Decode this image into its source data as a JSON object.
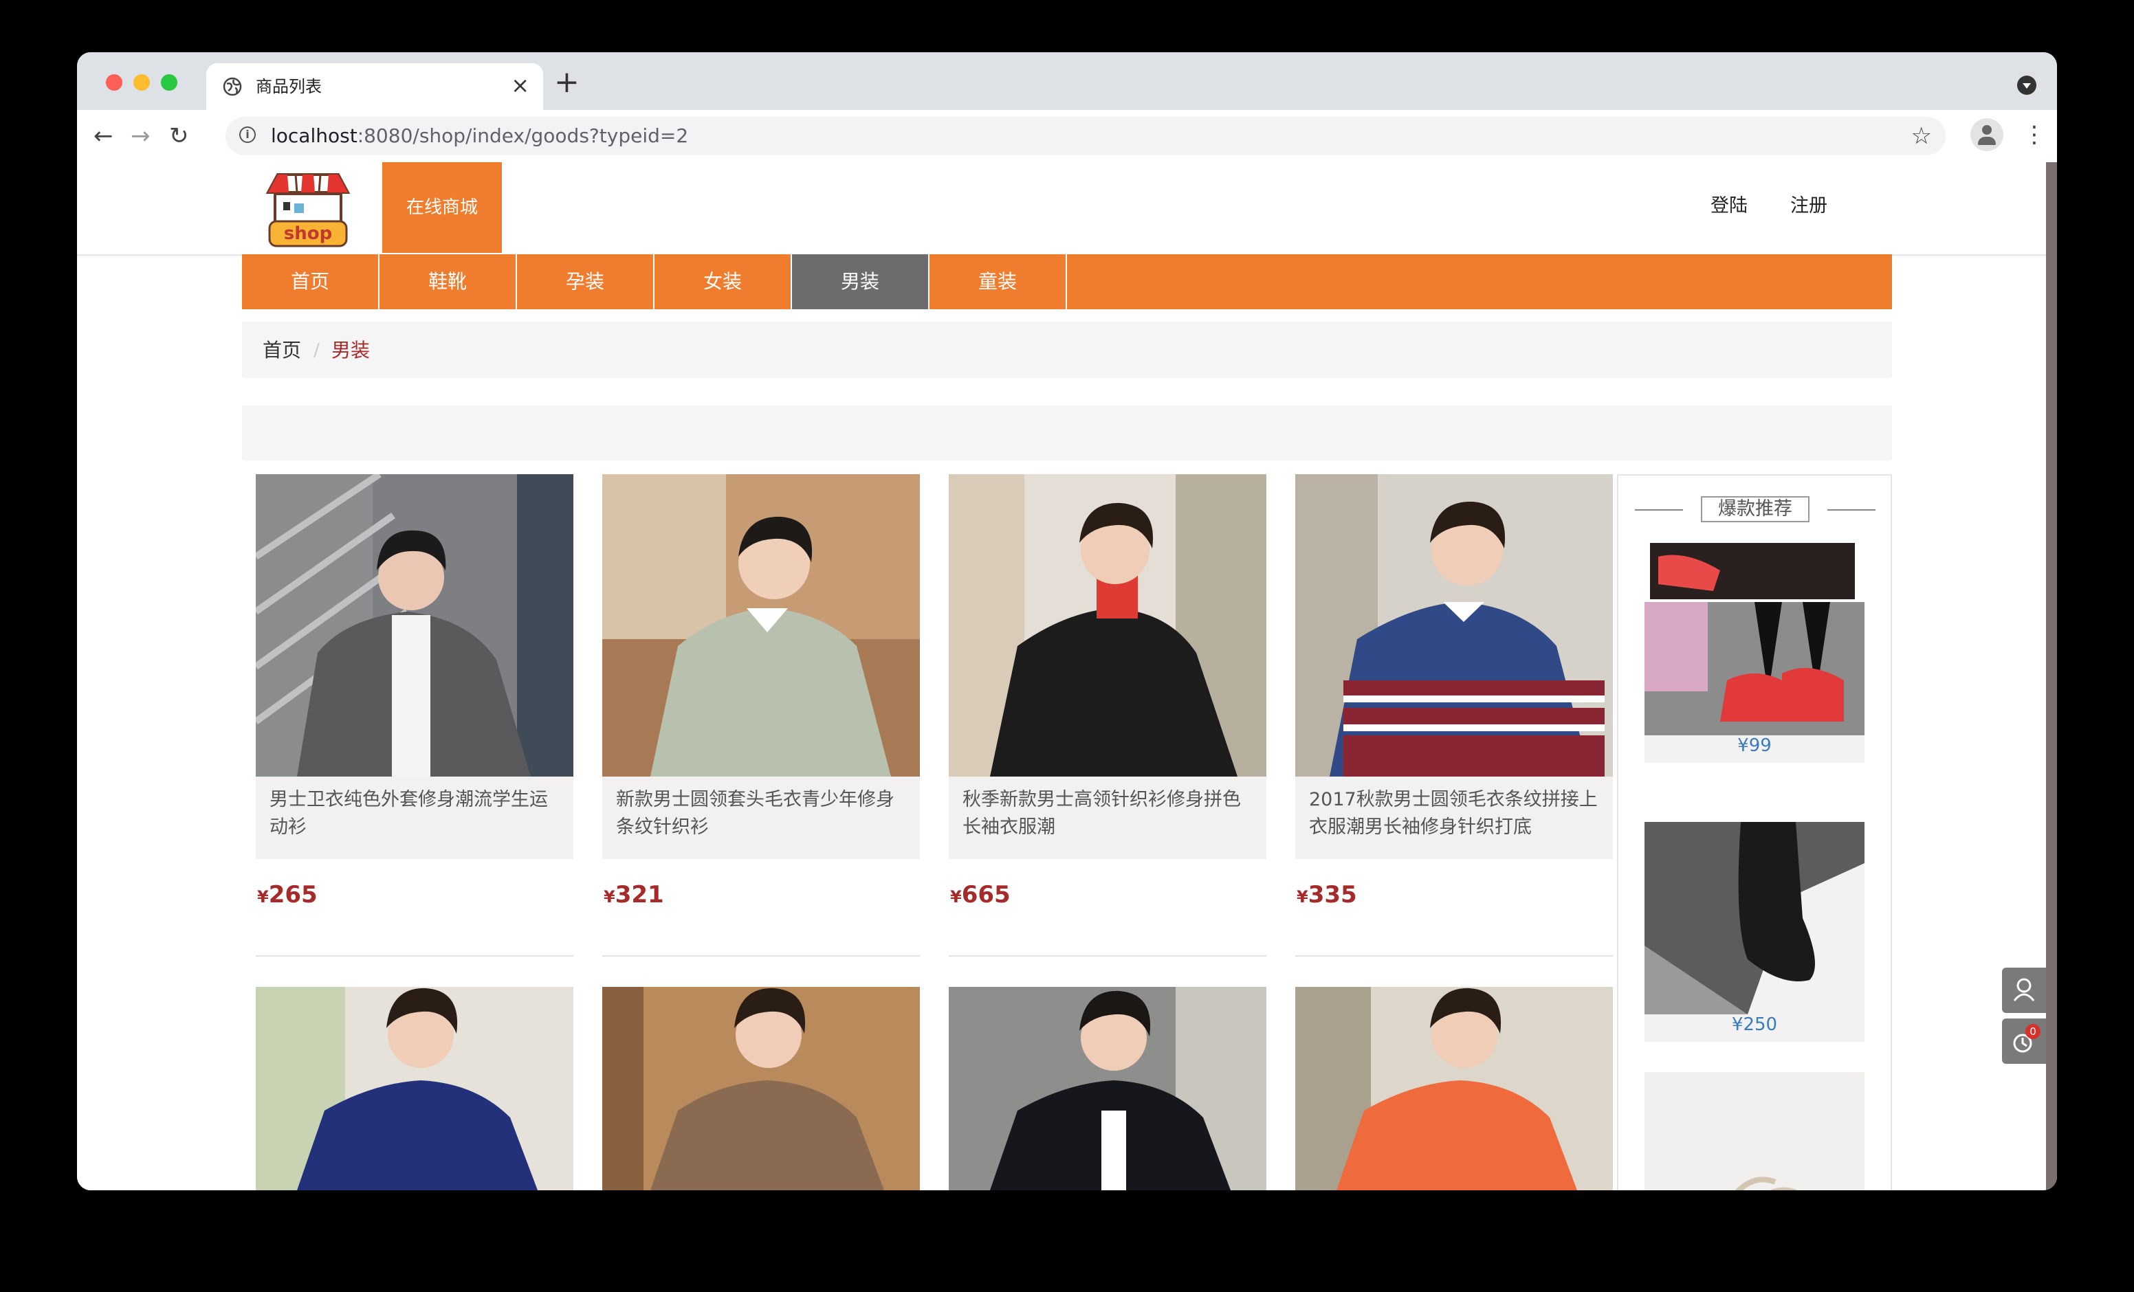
{
  "browser": {
    "tab_title": "商品列表",
    "url_host": "localhost",
    "url_path": ":8080/shop/index/goods?typeid=2"
  },
  "header": {
    "logo_text": "shop",
    "brand": "在线商城",
    "login": "登陆",
    "register": "注册"
  },
  "categories": [
    {
      "label": "首页",
      "active": false
    },
    {
      "label": "鞋靴",
      "active": false
    },
    {
      "label": "孕装",
      "active": false
    },
    {
      "label": "女装",
      "active": false
    },
    {
      "label": "男装",
      "active": true
    },
    {
      "label": "童装",
      "active": false
    }
  ],
  "breadcrumb": {
    "home": "首页",
    "separator": "/",
    "current": "男装"
  },
  "currency": "¥",
  "products": [
    {
      "name": "男士卫衣纯色外套修身潮流学生运动衫",
      "price": "265"
    },
    {
      "name": "新款男士圆领套头毛衣青少年修身条纹针织衫",
      "price": "321"
    },
    {
      "name": "秋季新款男士高领针织衫修身拼色长袖衣服潮",
      "price": "665"
    },
    {
      "name": "2017秋款男士圆领毛衣条纹拼接上衣服潮男长袖修身针织打底",
      "price": "335"
    }
  ],
  "sidebar": {
    "title": "爆款推荐",
    "items": [
      {
        "price": "¥99"
      },
      {
        "price": "¥250"
      }
    ]
  },
  "floating": {
    "cart_count": "0"
  },
  "colors": {
    "accent": "#f07c2e",
    "active_nav": "#6c6c6c",
    "price": "#a52a2a",
    "side_price": "#3a7bbf"
  }
}
